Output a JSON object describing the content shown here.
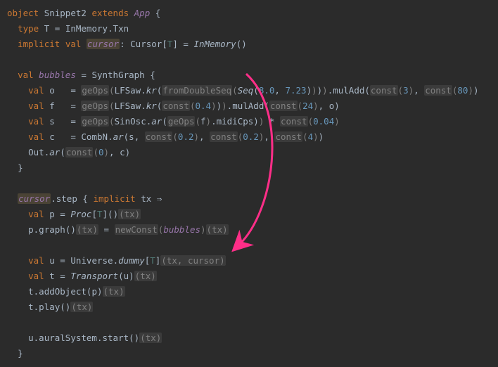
{
  "l1": {
    "kw_object": "object",
    "name": "Snippet2",
    "kw_extends": "extends",
    "app": "App",
    "brace": "{"
  },
  "l2": {
    "kw_type": "type",
    "T": "T",
    "eq": "=",
    "rhs": "InMemory.Txn"
  },
  "l3": {
    "kw_implicit": "implicit",
    "kw_val": "val",
    "name": "cursor",
    "colon": ":",
    "type": "Cursor",
    "lb": "[",
    "tp": "T",
    "rb": "]",
    "eq": "=",
    "rhs": "InMemory",
    "paren": "()"
  },
  "l5": {
    "kw_val": "val",
    "name": "bubbles",
    "eq": "=",
    "call": "SynthGraph",
    "brace": "{"
  },
  "l6": {
    "kw_val": "val",
    "name": "o",
    "eq": "=",
    "geOps": "geOps",
    "lp": "(",
    "cls": "LFSaw",
    "dot": ".",
    "m": "kr",
    "lp2": "(",
    "fds": "fromDoubleSeq",
    "lp3": "(",
    "seq": "Seq",
    "lp4": "(",
    "n1": "8.0",
    "comma": ",",
    "n2": "7.23",
    "rp4": ")",
    "rp3": ")",
    "rp2": ")",
    "rp1": ")",
    "dot2": ".",
    "mul": "mulAdd",
    "lp5": "(",
    "c1": "const",
    "lp6": "(",
    "n3": "3",
    "rp6": ")",
    "comma2": ",",
    "c2": "const",
    "lp7": "(",
    "n4": "80",
    "rp7": ")",
    "rp5": ")"
  },
  "l7": {
    "kw_val": "val",
    "name": "f",
    "eq": "=",
    "geOps": "geOps",
    "lp": "(",
    "cls": "LFSaw",
    "dot": ".",
    "m": "kr",
    "lp2": "(",
    "c1": "const",
    "lp3": "(",
    "n1": "0.4",
    "rp3": ")",
    "rp2": ")",
    "rp1": ")",
    "dot2": ".",
    "mul": "mulAdd",
    "lp4": "(",
    "c2": "const",
    "lp5": "(",
    "n2": "24",
    "rp5": ")",
    "comma": ",",
    "o": "o",
    "rp4": ")"
  },
  "l8": {
    "kw_val": "val",
    "name": "s",
    "eq": "=",
    "geOps": "geOps",
    "lp": "(",
    "cls": "SinOsc",
    "dot": ".",
    "m": "ar",
    "lp2": "(",
    "ge2": "geOps",
    "lp3": "(",
    "f": "f",
    "rp3": ")",
    "dot2": ".",
    "midi": "midiCps",
    "rp2": ")",
    "rp1": ")",
    "star": "*",
    "c1": "const",
    "lp4": "(",
    "n1": "0.04",
    "rp4": ")"
  },
  "l9": {
    "kw_val": "val",
    "name": "c",
    "eq": "=",
    "cls": "CombN",
    "dot": ".",
    "m": "ar",
    "lp": "(",
    "s": "s",
    "comma1": ",",
    "c1": "const",
    "lp1": "(",
    "n1": "0.2",
    "rp1": ")",
    "comma2": ",",
    "c2": "const",
    "lp2": "(",
    "n2": "0.2",
    "rp2": ")",
    "comma3": ",",
    "c3": "const",
    "lp3": "(",
    "n3": "4",
    "rp3": ")",
    "rp": ")"
  },
  "l10": {
    "out": "Out",
    "dot": ".",
    "m": "ar",
    "lp": "(",
    "c1": "const",
    "lp1": "(",
    "n1": "0",
    "rp1": ")",
    "comma": ",",
    "c": "c",
    "rp": ")"
  },
  "l11": {
    "brace": "}"
  },
  "l13": {
    "cursor": "cursor",
    "dot": ".",
    "step": "step",
    "brace": "{",
    "kw_implicit": "implicit",
    "tx": "tx",
    "arrow": "⇒"
  },
  "l14": {
    "kw_val": "val",
    "name": "p",
    "eq": "=",
    "proc": "Proc",
    "lb": "[",
    "tp": "T",
    "rb": "]",
    "paren": "()",
    "tx": "(tx)"
  },
  "l15": {
    "p": "p",
    "dot": ".",
    "graph": "graph",
    "paren": "()",
    "tx1": "(tx)",
    "eq": "=",
    "nc": "newConst",
    "lp": "(",
    "b": "bubbles",
    "rp": ")",
    "tx2": "(tx)"
  },
  "l17": {
    "kw_val": "val",
    "name": "u",
    "eq": "=",
    "uni": "Universe",
    "dot": ".",
    "dummy": "dummy",
    "lb": "[",
    "tp": "T",
    "rb": "]",
    "args": "(tx, cursor)"
  },
  "l18": {
    "kw_val": "val",
    "name": "t",
    "eq": "=",
    "tr": "Transport",
    "lp": "(",
    "u": "u",
    "rp": ")",
    "tx": "(tx)"
  },
  "l19": {
    "t": "t",
    "dot": ".",
    "m": "addObject",
    "lp": "(",
    "p": "p",
    "rp": ")",
    "tx": "(tx)"
  },
  "l20": {
    "t": "t",
    "dot": ".",
    "m": "play",
    "paren": "()",
    "tx": "(tx)"
  },
  "l22": {
    "u": "u",
    "dot1": ".",
    "as": "auralSystem",
    "dot2": ".",
    "start": "start",
    "paren": "()",
    "tx": "(tx)"
  },
  "l23": {
    "brace": "}"
  }
}
